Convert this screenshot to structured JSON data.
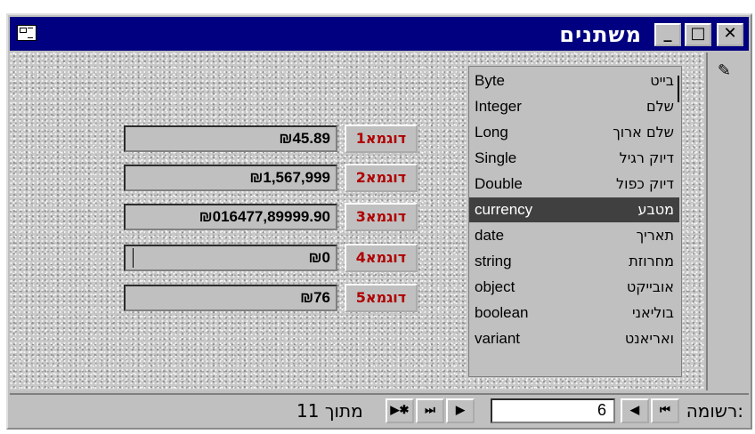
{
  "window": {
    "title": "משתנים"
  },
  "titlebar_buttons": {
    "minimize": "_",
    "maximize": "□",
    "close": "✕"
  },
  "form": {
    "pencil": "✎",
    "rows": [
      {
        "label": "דוגמא1",
        "value": "₪45.89"
      },
      {
        "label": "דוגמא2",
        "value": "₪1,567,999"
      },
      {
        "label": "דוגמא3",
        "value": "₪016477,89999.90"
      },
      {
        "label": "דוגמא4",
        "value": "₪0"
      },
      {
        "label": "דוגמא5",
        "value": "₪76"
      }
    ]
  },
  "list": {
    "selected_index": 5,
    "items": [
      {
        "en": "Byte",
        "he": "בייט"
      },
      {
        "en": "Integer",
        "he": "שלם"
      },
      {
        "en": "Long",
        "he": "שלם ארוך"
      },
      {
        "en": "Single",
        "he": "דיוק רגיל"
      },
      {
        "en": "Double",
        "he": "דיוק כפול"
      },
      {
        "en": "currency",
        "he": "מטבע"
      },
      {
        "en": "date",
        "he": "תאריך"
      },
      {
        "en": "string",
        "he": "מחרוזת"
      },
      {
        "en": "object",
        "he": "אובייקט"
      },
      {
        "en": "boolean",
        "he": "בוליאני"
      },
      {
        "en": "variant",
        "he": "ואריאנט"
      }
    ]
  },
  "navigation": {
    "record_label": "רשומה:",
    "current_record": "6",
    "of_text": "11 מתוך",
    "first": "⏮",
    "prev": "◀",
    "next": "▶",
    "last": "⏭",
    "new": "▶✱"
  }
}
